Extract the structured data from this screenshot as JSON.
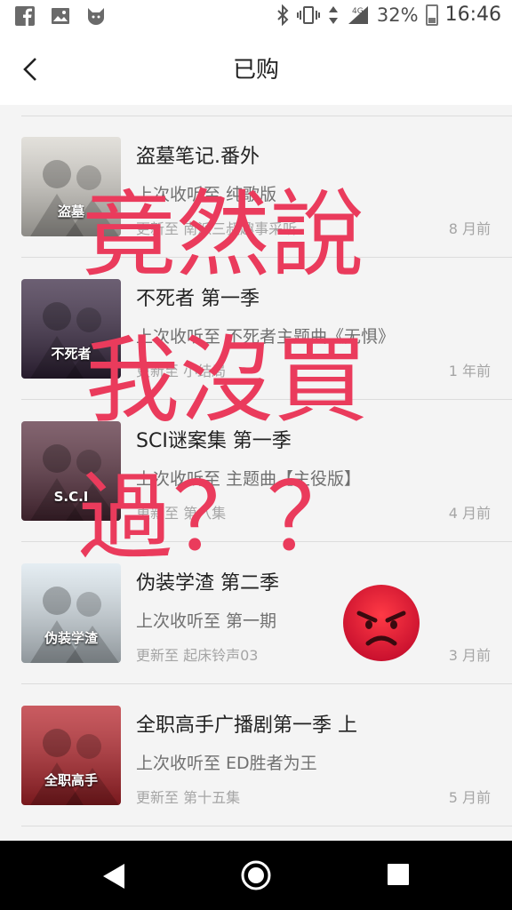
{
  "status_bar": {
    "icons_left": [
      "facebook-icon",
      "image-icon",
      "cat-app-icon"
    ],
    "icons_right": [
      "bluetooth-icon",
      "vibrate-icon",
      "data-arrows-icon",
      "signal-4g-icon"
    ],
    "network": "4G",
    "battery": "32%",
    "time": "16:46"
  },
  "header": {
    "title": "已购",
    "back_icon": "back-chevron-icon"
  },
  "items": [
    {
      "name": "盗墓笔记.番外",
      "played": "上次收听至 纯歌版",
      "update": "更新至 南派三叔趣事采听",
      "time": "8 月前",
      "cover_text": "盗墓",
      "cover_color": "#d9d6cf"
    },
    {
      "name": "不死者 第一季",
      "played": "上次收听至 不死者主题曲《无惧》",
      "update": "更新至 小结局",
      "time": "1 年前",
      "cover_text": "不死者",
      "cover_color": "#3b2a44"
    },
    {
      "name": "SCI谜案集 第一季",
      "played": "上次收听至 主题曲【主役版】",
      "update": "更新至 第八集",
      "time": "4 月前",
      "cover_text": "S.C.I",
      "cover_color": "#5a3140"
    },
    {
      "name": "伪装学渣 第二季",
      "played": "上次收听至 第一期",
      "update": "更新至 起床铃声03",
      "time": "3 月前",
      "cover_text": "伪装学渣",
      "cover_color": "#dce7ee"
    },
    {
      "name": "全职高手广播剧第一季 上",
      "played": "上次收听至 ED胜者为王",
      "update": "更新至 第十五集",
      "time": "5 月前",
      "cover_text": "全职高手",
      "cover_color": "#b8252c"
    }
  ],
  "overlay": {
    "lines": [
      "竟然說",
      "我沒買",
      "過？？"
    ],
    "emoji": "angry-face-icon",
    "color": "#ea3b5c"
  },
  "nav_bar": {
    "buttons": [
      "back-triangle-icon",
      "home-circle-icon",
      "recents-square-icon"
    ]
  }
}
